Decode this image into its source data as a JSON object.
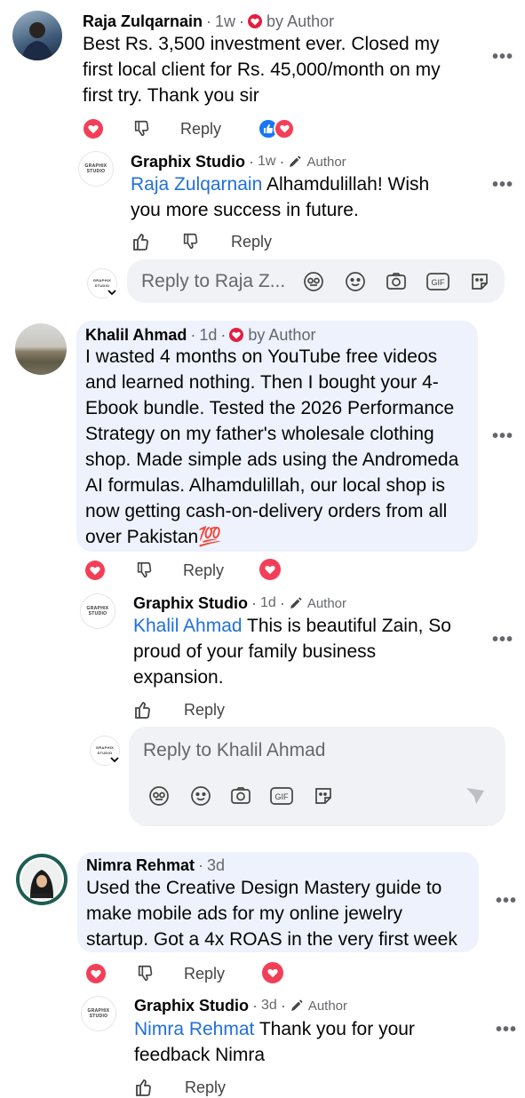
{
  "comments": [
    {
      "name": "Raja Zulqarnain",
      "time": "1w",
      "badge": "by Author",
      "text_lines": [
        "Best Rs. 3,500 investment ever. Closed my",
        "first local client for Rs. 45,000/month on my",
        "first try. Thank you sir"
      ],
      "reply_label": "Reply",
      "reply": {
        "name": "Graphix Studio",
        "time": "1w",
        "badge": "Author",
        "mention": "Raja Zulqarnain",
        "text_first": " Alhamdulillah! Wish",
        "text_lines": [
          "you more success in future."
        ],
        "reply_label": "Reply"
      },
      "reply_box_placeholder": "Reply to Raja Z..."
    },
    {
      "name": "Khalil Ahmad",
      "time": "1d",
      "badge": "by Author",
      "text_lines": [
        "I wasted 4 months on YouTube free videos",
        "and learned nothing. Then I bought your 4-",
        "Ebook bundle. Tested the 2026 Performance",
        "Strategy on my father's wholesale clothing",
        "shop. Made simple ads using the Andromeda",
        "AI formulas. Alhamdulillah, our local shop is",
        "now getting cash-on-delivery orders from all",
        "over Pakistan💯"
      ],
      "reply_label": "Reply",
      "reply": {
        "name": "Graphix Studio",
        "time": "1d",
        "badge": "Author",
        "mention": "Khalil Ahmad",
        "text_first": " This is beautiful Zain, So",
        "text_lines": [
          "proud of your family business",
          "expansion."
        ],
        "reply_label": "Reply"
      },
      "reply_box_placeholder": "Reply to Khalil Ahmad"
    },
    {
      "name": "Nimra Rehmat",
      "time": "3d",
      "text_lines": [
        "Used the Creative Design Mastery guide to",
        "make mobile ads for my online jewelry",
        "startup. Got a 4x ROAS in the very first week"
      ],
      "reply_label": "Reply",
      "reply": {
        "name": "Graphix Studio",
        "time": "3d",
        "badge": "Author",
        "mention": "Nimra Rehmat",
        "text_first": " Thank you for your",
        "text_lines": [
          "feedback Nimra"
        ],
        "reply_label": "Reply"
      }
    }
  ],
  "page_logo_text": [
    "GRAPHIX",
    "STUDIO"
  ],
  "more_label": "•••",
  "colors": {
    "love": "#f33e58",
    "like": "#1877f2",
    "mention": "#216fdb",
    "bubble": "#edf2fc"
  }
}
